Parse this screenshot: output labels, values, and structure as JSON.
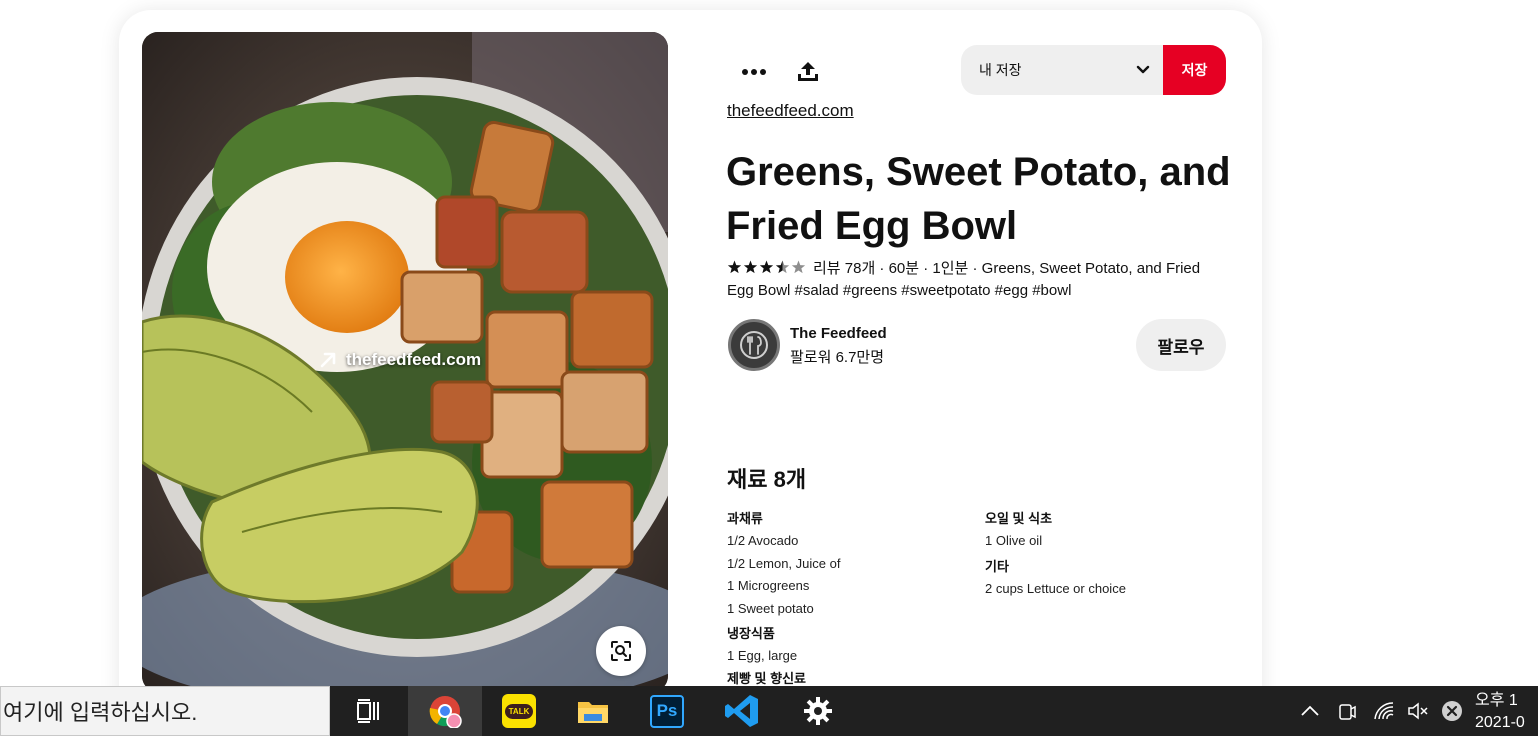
{
  "pin": {
    "image_link_text": "thefeedfeed.com",
    "source_link": "thefeedfeed.com",
    "title": "Greens, Sweet Potato, and Fried Egg Bowl",
    "rating": 3.5,
    "rating_max": 5,
    "meta_text": "리뷰 78개 · 60분 · 1인분 · Greens, Sweet Potato, and Fried Egg Bowl #salad #greens #sweetpotato #egg #bowl"
  },
  "toolbar": {
    "more_icon": "more-horizontal-icon",
    "share_icon": "share-upload-icon",
    "board_select": "내 저장",
    "save_label": "저장"
  },
  "creator": {
    "name": "The Feedfeed",
    "followers": "팔로워 6.7만명",
    "follow_label": "팔로우"
  },
  "ingredients": {
    "title": "재료 8개",
    "left": [
      {
        "category": "과채류",
        "items": [
          "1/2 Avocado",
          "1/2 Lemon, Juice of",
          "1 Microgreens",
          "1 Sweet potato"
        ]
      },
      {
        "category": "냉장식품",
        "items": [
          "1 Egg, large"
        ]
      },
      {
        "category": "제빵 및 향신료",
        "items": []
      }
    ],
    "right": [
      {
        "category": "오일 및 식초",
        "items": [
          "1 Olive oil"
        ]
      },
      {
        "category": "기타",
        "items": [
          "2 cups Lettuce or choice"
        ]
      }
    ]
  },
  "taskbar": {
    "search_placeholder": "여기에 입력하십시오.",
    "apps": [
      "task-view-icon",
      "chrome-icon",
      "kakaotalk-icon",
      "file-explorer-icon",
      "photoshop-icon",
      "vscode-icon",
      "settings-gear-icon"
    ],
    "kakao_label": "TALK",
    "ps_label": "Ps",
    "clock_time": "오후 1",
    "clock_date": "2021-0"
  },
  "colors": {
    "save_red": "#e60023",
    "taskbar_bg": "#202020",
    "pill_gray": "#efefef"
  }
}
